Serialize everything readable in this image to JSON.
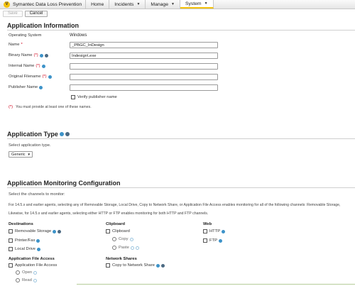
{
  "header": {
    "brand": "Symantec Data Loss Prevention",
    "logo_letter": "V",
    "nav": [
      {
        "label": "Home",
        "dropdown": false
      },
      {
        "label": "Incidents",
        "dropdown": true
      },
      {
        "label": "Manage",
        "dropdown": true
      },
      {
        "label": "System",
        "dropdown": true,
        "active": true
      }
    ]
  },
  "toolbar": {
    "save_label": "Save",
    "cancel_label": "Cancel"
  },
  "app_info": {
    "title": "Application Information",
    "os_label": "Operating System",
    "os_value": "Windows",
    "name_label": "Name",
    "name_value": "_PBGC_InDesign",
    "binary_label": "Binary Name",
    "binary_value": "Indesign\\.exe",
    "internal_label": "Internal Name",
    "internal_value": "",
    "original_label": "Original Filename",
    "original_value": "",
    "publisher_label": "Publisher Name",
    "publisher_value": "",
    "verify_label": "Verify publisher name",
    "required_mark": "*",
    "either_mark": "(*)",
    "footnote": "You must provide at least one of these names."
  },
  "app_type": {
    "title": "Application Type",
    "select_label": "Select application type.",
    "selected": "Generic"
  },
  "monitoring": {
    "title": "Application Monitoring Configuration",
    "select_label": "Select the channels to monitor:",
    "note1": "For 14.5.x and earlier agents, selecting any of Removable Storage, Local Drive, Copy to Network Share, or Application File Access enables monitoring for all of the following channels: Removable Storage,",
    "note2": "Likewise, for 14.5.x and earlier agents, selecting either HTTP or FTP enables monitoring for both HTTP and FTP channels.",
    "destinations": {
      "title": "Destinations",
      "removable": "Removable Storage",
      "printer": "Printer/Fax",
      "local": "Local Drive"
    },
    "clipboard": {
      "title": "Clipboard",
      "clipboard": "Clipboard",
      "copy": "Copy",
      "paste": "Paste"
    },
    "web": {
      "title": "Web",
      "http": "HTTP",
      "ftp": "FTP"
    },
    "file_access": {
      "title": "Application File Access",
      "access": "Application File Access",
      "open": "Open",
      "read": "Read"
    },
    "network": {
      "title": "Network Shares",
      "copy": "Copy to Network Share"
    }
  },
  "colors": {
    "accent": "#f4c20d",
    "help": "#3d93c9",
    "required": "#d0021b"
  }
}
